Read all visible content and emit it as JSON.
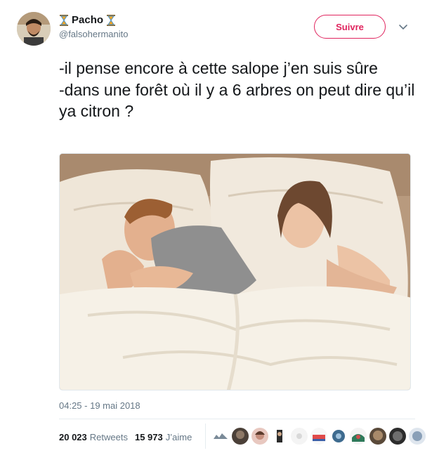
{
  "user": {
    "name": "Pacho",
    "handle": "@falsohermanito"
  },
  "follow": {
    "label": "Suivre"
  },
  "tweet": {
    "text": "-il pense encore à cette salope j’en suis sûre\n-dans une forêt où il y a 6 arbres on peut dire qu’il ya citron ?"
  },
  "meta": {
    "timestamp": "04:25 - 19 mai 2018"
  },
  "stats": {
    "retweets_count": "20 023",
    "retweets_label": "Retweets",
    "likes_count": "15 973",
    "likes_label": "J’aime"
  },
  "colors": {
    "accent": "#e0245e",
    "secondary_text": "#657786",
    "hourglass": "#f5a623"
  },
  "icons": [
    "hourglass-icon",
    "chevron-down-icon"
  ]
}
